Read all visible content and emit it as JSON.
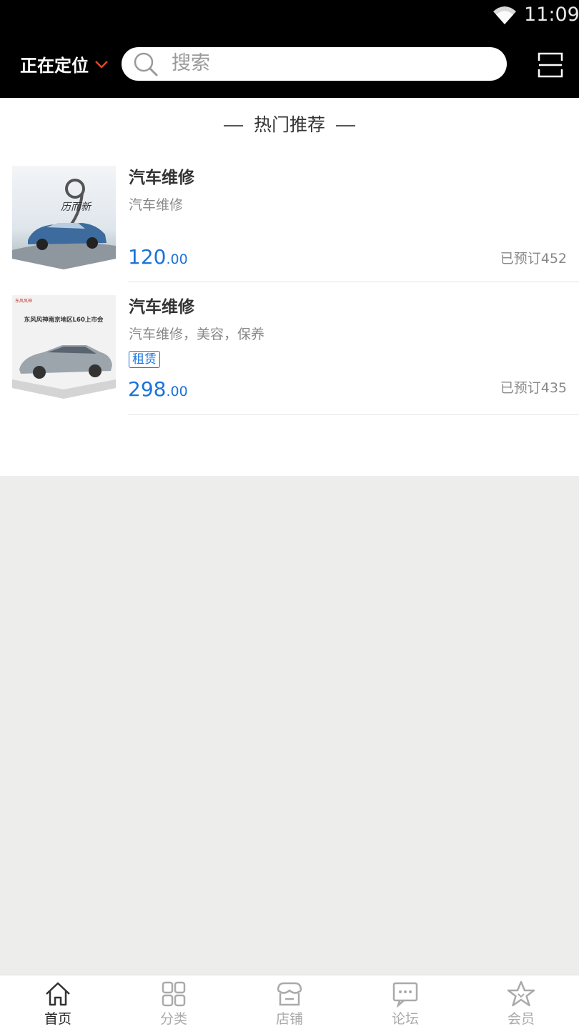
{
  "status_bar": {
    "time": "11:09"
  },
  "header": {
    "location_label": "正在定位",
    "search_placeholder": "搜索"
  },
  "section": {
    "title": "热门推荐"
  },
  "products": [
    {
      "name": "汽车维修",
      "description": "汽车维修",
      "tag": "",
      "price_int": "120",
      "price_dec": ".00",
      "sold": "已预订452",
      "thumb_caption": "历而新"
    },
    {
      "name": "汽车维修",
      "description": "汽车维修，美容，保养",
      "tag": "租赁",
      "price_int": "298",
      "price_dec": ".00",
      "sold": "已预订435",
      "thumb_caption": "东风风神南京地区L60上市会"
    }
  ],
  "tabbar": {
    "items": [
      {
        "label": "首页",
        "icon": "home-icon",
        "active": true
      },
      {
        "label": "分类",
        "icon": "grid-icon",
        "active": false
      },
      {
        "label": "店铺",
        "icon": "store-icon",
        "active": false
      },
      {
        "label": "论坛",
        "icon": "forum-icon",
        "active": false
      },
      {
        "label": "会员",
        "icon": "star-icon",
        "active": false
      }
    ]
  },
  "colors": {
    "accent": "#1a73d9",
    "header_bg": "#000000",
    "chevron": "#e8452c",
    "page_bg": "#ededeb"
  }
}
